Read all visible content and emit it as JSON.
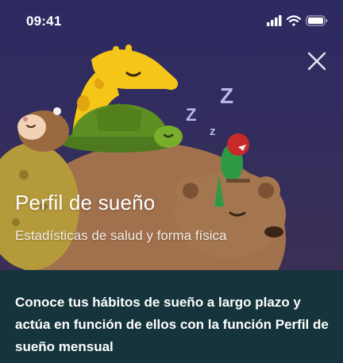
{
  "status_bar": {
    "time": "09:41",
    "icons": [
      "signal-icon",
      "wifi-icon",
      "battery-icon"
    ]
  },
  "header": {
    "close_icon": "close-icon"
  },
  "hero": {
    "illustration": "sleeping-animals-illustration",
    "title": "Perfil de sueño",
    "subtitle": "Estadísticas de salud y forma física",
    "sleep_letters": [
      "Z",
      "Z",
      "z"
    ]
  },
  "body": {
    "description": "Conoce tus hábitos de sueño a largo plazo y actúa en función de ellos con la función Perfil de sueño mensual"
  },
  "colors": {
    "hero_background": "#2d2a62",
    "panel_background": "#16343c",
    "text": "#ffffff",
    "zzz": "#b7b9e8"
  }
}
